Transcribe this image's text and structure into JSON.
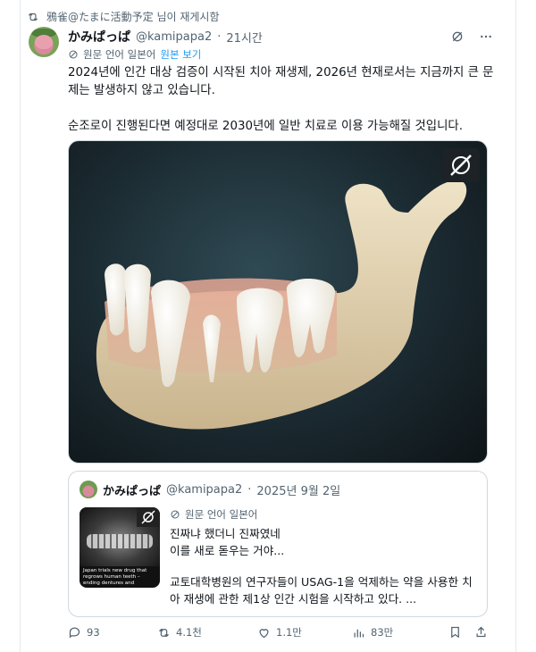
{
  "repost": {
    "text": "鴉雀@たまに活動予定 님이 재게시함"
  },
  "post": {
    "author_name": "かみぱっぱ",
    "handle": "@kamipapa2",
    "separator": "·",
    "time": "21시간",
    "translate_label": "원문 언어 일본어",
    "translate_link": "원본 보기",
    "text_1": "2024년에 인간 대상 검증이 시작된 치아 재생제, 2026년 현재로서는 지금까지 큰 문제는 발생하지 않고 있습니다.",
    "text_2": "순조로이 진행된다면 예정대로 2030년에 일반 치료로 이용 가능해질 것입니다."
  },
  "quote": {
    "author_name": "かみぱっぱ",
    "handle": "@kamipapa2",
    "separator": "·",
    "date": "2025년 9월 2일",
    "translate_label": "원문 언어 일본어",
    "text_1": "진짜냐 했더니 진짜였네\n이를 새로 돋우는 거야...",
    "text_2": "교토대학병원의 연구자들이 USAG-1을 억제하는 약을 사용한 치아 재생에 관한 제1상 인간 시험을 시작하고 있다. ...",
    "image_caption": "Japan trials new drug that regrows human teeth – ending dentures and"
  },
  "actions": {
    "replies": "93",
    "reposts": "4.1천",
    "likes": "1.1만",
    "views": "83만"
  },
  "icons": {
    "repost": "repost-icon",
    "grok": "grok-icon",
    "more": "more-icon",
    "translate": "translate-icon",
    "reply": "reply-icon",
    "like": "heart-icon",
    "views": "views-icon",
    "bookmark": "bookmark-icon",
    "share": "share-icon"
  },
  "colors": {
    "text": "#0f1419",
    "secondary": "#536471",
    "link": "#1d9bf0",
    "border": "#cfd9de"
  }
}
